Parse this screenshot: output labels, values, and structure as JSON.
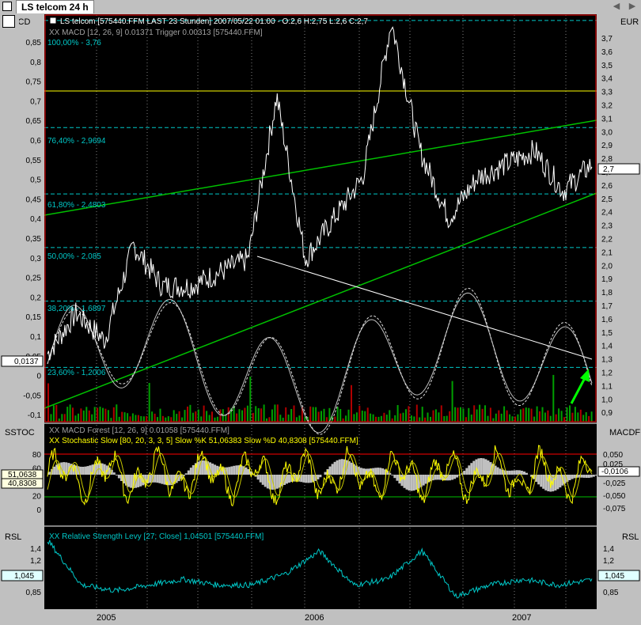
{
  "window": {
    "tab_title": "LS telcom 24 h"
  },
  "header": {
    "title_line": "LS telcom [575440.FFM LAST 23 Stunden] 2007/05/22 01:00 - O:2,6 H:2,75 L:2,6 C:2,7",
    "macd_legend": "XX MACD [12, 26, 9] 0.01371 Trigger 0.00313 [575440.FFM]"
  },
  "axes": {
    "left_top_label": "MACD",
    "right_top_label": "EUR",
    "left_mid_label": "SSTOC",
    "right_mid_label": "MACDF",
    "left_bottom_label": "RSL",
    "right_bottom_label": "RSL",
    "macd_ticks": [
      "0,85",
      "0,8",
      "0,75",
      "0,7",
      "0,65",
      "0,6",
      "0,55",
      "0,5",
      "0,45",
      "0,4",
      "0,35",
      "0,3",
      "0,25",
      "0,2",
      "0,15",
      "0,1",
      "0,05",
      "0",
      "-0,05",
      "-0,1"
    ],
    "price_ticks": [
      "3,7",
      "3,6",
      "3,5",
      "3,4",
      "3,3",
      "3,2",
      "3,1",
      "3,0",
      "2,9",
      "2,8",
      "2,7",
      "2,6",
      "2,5",
      "2,4",
      "2,3",
      "2,2",
      "2,1",
      "2,0",
      "1,9",
      "1,8",
      "1,7",
      "1,6",
      "1,5",
      "1,4",
      "1,3",
      "1,2",
      "1,1",
      "1,0",
      "0,9"
    ],
    "stoch_ticks": [
      "80",
      "60",
      "40",
      "20",
      "0"
    ],
    "macdf_ticks": [
      "0,050",
      "0,025",
      "-0,025",
      "-0,050",
      "-0,075"
    ],
    "rsl_left_ticks": [
      "1,4",
      "1,2",
      "0,85"
    ],
    "rsl_right_ticks": [
      "1,4",
      "1,2",
      "0,85"
    ],
    "x_ticks": [
      "2005",
      "2006",
      "2007"
    ]
  },
  "readouts": {
    "macd_value": "0,0137",
    "price_value": "2,7",
    "stoch_k": "51,0638",
    "stoch_d": "40,8308",
    "macdf_value": "-0,0106",
    "rsl_left": "1,045",
    "rsl_right": "1,045"
  },
  "fib_labels": [
    "100,00% - 3,76",
    "76,40% - 2,9694",
    "61,80% - 2,4803",
    "50,00% - 2,085",
    "38,20% - 1,6897",
    "23,60% - 1,2006"
  ],
  "stoch_legend": {
    "forest": "XX MACD Forest [12, 26, 9] 0.01058 [575440.FFM]",
    "stochastic": "XX Stochastic Slow [80, 20, 3, 3, 5] Slow %K 51,06383 Slow %D 40,8308 [575440.FFM]"
  },
  "rsl_legend": "XX Relative Strength Levy [27; Close] 1,04501 [575440.FFM]",
  "colors": {
    "background": "#000000",
    "price": "#ffffff",
    "macd": "#c0c0c0",
    "fib": "#00c8c8",
    "trend": "#00c000",
    "yellow_line": "#ffff00",
    "frame": "#ff0000",
    "volume_green": "#00a000",
    "volume_red": "#b00000",
    "stoch": "#ffff00",
    "rsl": "#00c8c8",
    "arrow": "#00ff00"
  },
  "chart_data": [
    {
      "type": "line",
      "title": "LS telcom [575440.FFM LAST 23 Stunden] 2007/05/22 01:00 - O:2,6 H:2,75 L:2,6 C:2,7",
      "ylabel": "EUR",
      "ylim": [
        0.8,
        3.8
      ],
      "x": [
        "2004-08",
        "2004-10",
        "2004-12",
        "2005-02",
        "2005-04",
        "2005-06",
        "2005-08",
        "2005-10",
        "2005-11",
        "2006-01",
        "2006-02",
        "2006-03",
        "2006-04",
        "2006-05",
        "2006-07",
        "2006-09",
        "2006-11",
        "2007-01",
        "2007-03",
        "2007-05"
      ],
      "series": [
        {
          "values": [
            1.3,
            1.6,
            1.4,
            2.1,
            1.8,
            1.8,
            1.9,
            2.0,
            3.2,
            2.0,
            2.3,
            2.6,
            3.75,
            2.8,
            2.3,
            2.6,
            2.7,
            2.8,
            2.5,
            2.7
          ]
        }
      ],
      "horizontal_lines": [
        {
          "label": "100,00% - 3,76",
          "value": 3.76
        },
        {
          "label": "76,40% - 2,9694",
          "value": 2.9694
        },
        {
          "label": "61,80% - 2,4803",
          "value": 2.4803
        },
        {
          "label": "50,00% - 2,085",
          "value": 2.085
        },
        {
          "label": "38,20% - 1,6897",
          "value": 1.6897
        },
        {
          "label": "23,60% - 1,2006",
          "value": 1.2006
        },
        {
          "value": 3.3
        }
      ],
      "grid": true
    },
    {
      "type": "line",
      "title": "XX Stochastic Slow [80, 20, 3, 3, 5] Slow %K 51,06383 Slow %D 40,8308 [575440.FFM]",
      "ylim": [
        -10,
        100
      ],
      "series": [
        {
          "name": "Slow %K",
          "values": [
            51.06383
          ]
        },
        {
          "name": "Slow %D",
          "values": [
            40.8308
          ]
        }
      ],
      "horizontal_lines": [
        {
          "value": 80
        },
        {
          "value": 20
        }
      ]
    },
    {
      "type": "line",
      "title": "XX Relative Strength Levy [27; Close] 1,04501 [575440.FFM]",
      "ylim": [
        0.8,
        1.5
      ],
      "series": [
        {
          "values": [
            1.4,
            1.0,
            0.95,
            1.0,
            1.05,
            1.0,
            1.0,
            1.1,
            1.3,
            1.0,
            1.05,
            1.3,
            0.9,
            1.0,
            1.05,
            1.0,
            1.045
          ]
        }
      ]
    }
  ]
}
